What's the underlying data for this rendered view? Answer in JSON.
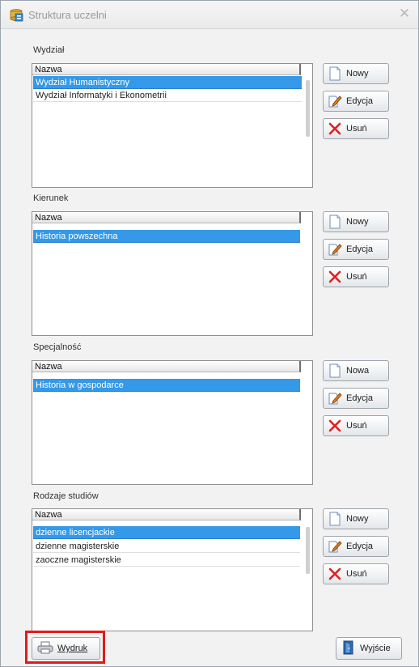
{
  "window": {
    "title": "Struktura uczelni",
    "app_icon": "database-icon",
    "close_icon": "close-icon"
  },
  "sections": [
    {
      "label": "Wydział",
      "column": "Nazwa",
      "rows": [
        {
          "text": "Wydział Humanistyczny",
          "selected": true
        },
        {
          "text": "Wydział Informatyki i Ekonometrii",
          "selected": false
        }
      ],
      "buttons": {
        "new": "Nowy",
        "edit": "Edycja",
        "delete": "Usuń"
      }
    },
    {
      "label": "Kierunek",
      "column": "Nazwa",
      "rows": [
        {
          "text": "Historia powszechna",
          "selected": true
        }
      ],
      "buttons": {
        "new": "Nowy",
        "edit": "Edycja",
        "delete": "Usuń"
      }
    },
    {
      "label": "Specjalność",
      "column": "Nazwa",
      "rows": [
        {
          "text": "Historia w gospodarce",
          "selected": true
        }
      ],
      "buttons": {
        "new": "Nowa",
        "edit": "Edycja",
        "delete": "Usuń"
      }
    },
    {
      "label": "Rodzaje studiów",
      "column": "Nazwa",
      "rows": [
        {
          "text": "dzienne licencjackie",
          "selected": true
        },
        {
          "text": "dzienne magisterskie",
          "selected": false
        },
        {
          "text": "zaoczne magisterskie",
          "selected": false
        }
      ],
      "buttons": {
        "new": "Nowy",
        "edit": "Edycja",
        "delete": "Usuń"
      }
    }
  ],
  "footer": {
    "print": "Wydruk",
    "exit": "Wyjście"
  },
  "colors": {
    "selection": "#3399e8",
    "highlight_border": "#e11b1b"
  }
}
